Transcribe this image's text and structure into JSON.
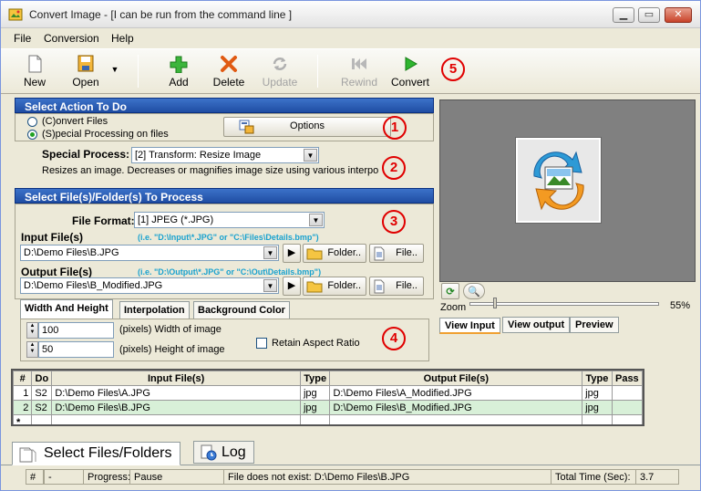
{
  "window": {
    "title": "Convert Image - [I can be run from the command line ]"
  },
  "menu": {
    "items": [
      "File",
      "Conversion",
      "Help"
    ]
  },
  "toolbar": {
    "new": "New",
    "open": "Open",
    "add": "Add",
    "delete": "Delete",
    "update": "Update",
    "rewind": "Rewind",
    "convert": "Convert"
  },
  "markers": [
    "1",
    "2",
    "3",
    "4",
    "5"
  ],
  "action": {
    "header": "Select Action To Do",
    "convert_files": "(C)onvert Files",
    "special_processing": "(S)pecial Processing on files",
    "options_button": "Options",
    "special_process_label": "Special Process:",
    "special_process_value": "[2] Transform: Resize Image",
    "description": "Resizes an image. Decreases or magnifies image size using various interpolatio"
  },
  "files": {
    "header": "Select File(s)/Folder(s) To Process",
    "file_format_label": "File Format:",
    "file_format_value": "[1] JPEG (*.JPG)",
    "input_label": "Input File(s)",
    "input_hint": "(i.e. \"D:\\Input\\*.JPG\"  or  \"C:\\Files\\Details.bmp\")",
    "input_value": "D:\\Demo Files\\B.JPG",
    "output_label": "Output File(s)",
    "output_hint": "(i.e. \"D:\\Output\\*.JPG\"  or  \"C:\\Out\\Details.bmp\")",
    "output_value": "D:\\Demo Files\\B_Modified.JPG",
    "folder_button": "Folder..",
    "file_button": "File.."
  },
  "settings": {
    "tabs": [
      "Width And Height",
      "Interpolation",
      "Background Color"
    ],
    "width_value": "100",
    "width_label": "(pixels) Width of image",
    "height_value": "50",
    "height_label": "(pixels) Height of image",
    "retain_aspect": "Retain Aspect Ratio"
  },
  "preview": {
    "zoom_label": "Zoom",
    "zoom_value": "55%",
    "zoom_fraction": 0.55,
    "tabs": [
      "View Input",
      "View output",
      "Preview"
    ]
  },
  "grid": {
    "headers": [
      "#",
      "Do",
      "Input File(s)",
      "Type",
      "Output File(s)",
      "Type",
      "Pass"
    ],
    "rows": [
      [
        "1",
        "S2",
        "D:\\Demo Files\\A.JPG",
        "jpg",
        "D:\\Demo Files\\A_Modified.JPG",
        "jpg",
        ""
      ],
      [
        "2",
        "S2",
        "D:\\Demo Files\\B.JPG",
        "jpg",
        "D:\\Demo Files\\B_Modified.JPG",
        "jpg",
        ""
      ]
    ],
    "new_row_marker": "*"
  },
  "bottom_tabs": {
    "select": "Select Files/Folders",
    "log": "Log"
  },
  "status": {
    "hash": "#",
    "dash": "-",
    "progress_label": "Progress:",
    "progress_value": "Pause",
    "message": "File does not exist: D:\\Demo Files\\B.JPG",
    "total_label": "Total Time (Sec):",
    "total_value": "3.7"
  }
}
